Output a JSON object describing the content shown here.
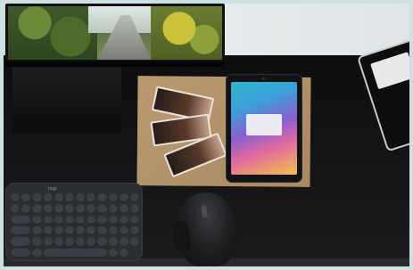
{
  "scene": {
    "monitor_screen_text": "",
    "keyboard_brand": "logi"
  },
  "colors": {
    "desk": "#151517",
    "cardboard": "#b0916a",
    "tablet_bezel": "#121316",
    "keyboard": "#2b2d31",
    "mouse": "#1b1c1e"
  }
}
